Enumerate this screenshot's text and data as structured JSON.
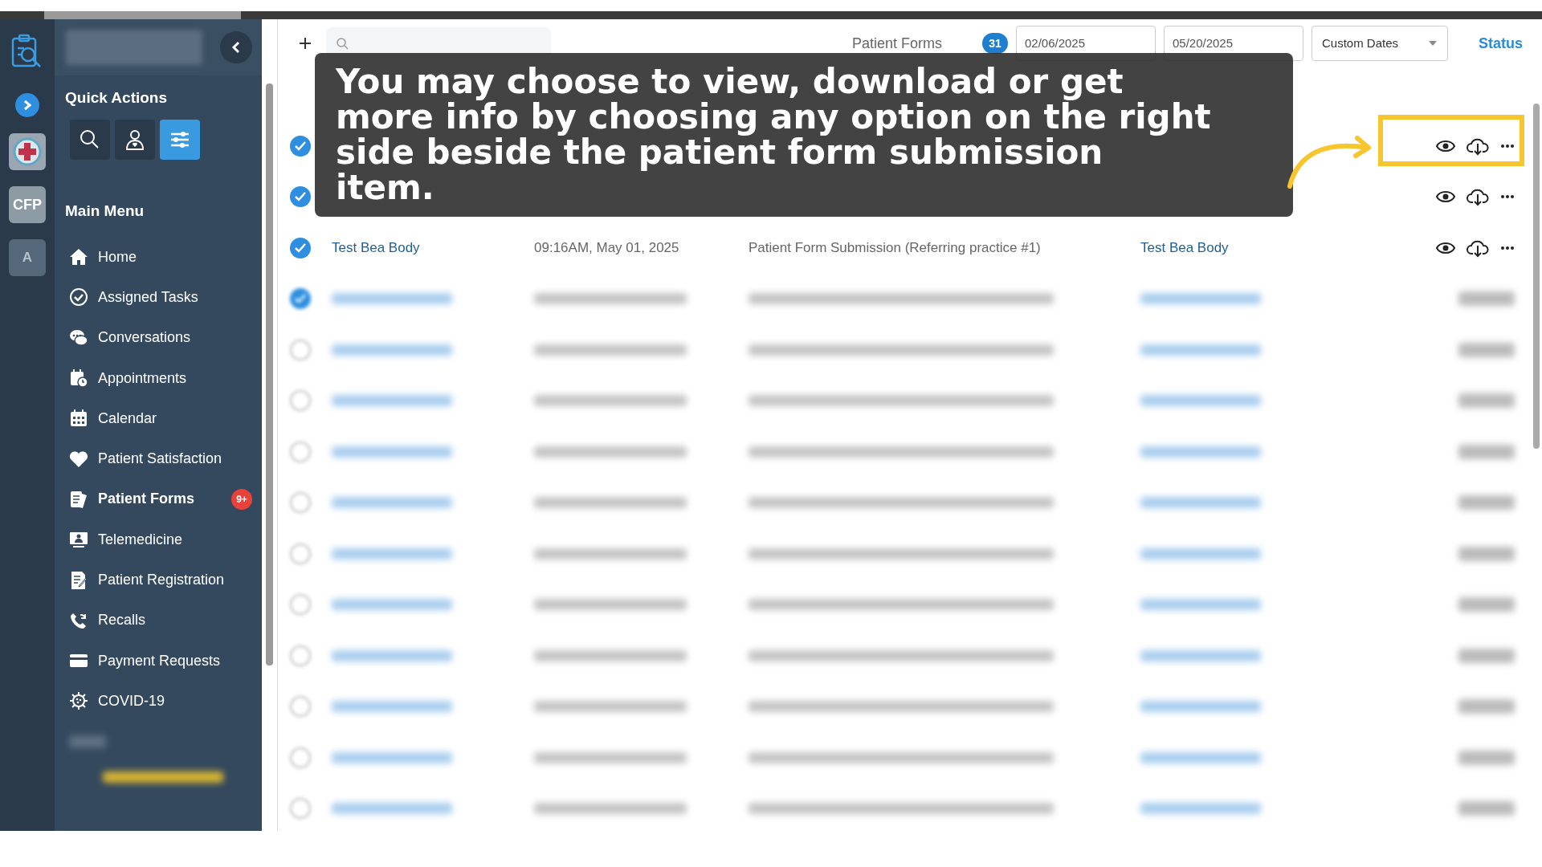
{
  "rail": {
    "accounts": [
      {
        "label": "CFP",
        "selected": true
      },
      {
        "label": "A",
        "selected": false
      }
    ]
  },
  "quick_actions": {
    "title": "Quick Actions",
    "buttons": [
      {
        "kind": "search",
        "selected": false
      },
      {
        "kind": "patient",
        "selected": false
      },
      {
        "kind": "filters",
        "selected": true
      }
    ]
  },
  "main_menu": {
    "title": "Main Menu",
    "items": [
      {
        "kind": "home",
        "label": "Home",
        "selected": false
      },
      {
        "kind": "tasks",
        "label": "Assigned Tasks",
        "selected": false
      },
      {
        "kind": "chat",
        "label": "Conversations",
        "selected": false
      },
      {
        "kind": "appointments",
        "label": "Appointments",
        "selected": false
      },
      {
        "kind": "calendar",
        "label": "Calendar",
        "selected": false
      },
      {
        "kind": "heart",
        "label": "Patient Satisfaction",
        "selected": false
      },
      {
        "kind": "forms",
        "label": "Patient Forms",
        "selected": true,
        "badge": "9+"
      },
      {
        "kind": "telemedicine",
        "label": "Telemedicine",
        "selected": false
      },
      {
        "kind": "registration",
        "label": "Patient Registration",
        "selected": false
      },
      {
        "kind": "recalls",
        "label": "Recalls",
        "selected": false
      },
      {
        "kind": "payment",
        "label": "Payment Requests",
        "selected": false
      },
      {
        "kind": "virus",
        "label": "COVID-19",
        "selected": false
      }
    ]
  },
  "header": {
    "title": "Patient Forms",
    "count": "31",
    "date_from": "02/06/2025",
    "date_to": "05/20/2025",
    "range": "Custom Dates",
    "status_link": "Status"
  },
  "table": {
    "rows": [
      {
        "kind": "visible",
        "checked": true
      },
      {
        "kind": "visible",
        "checked": true
      },
      {
        "kind": "visible",
        "checked": true,
        "name": "Test Bea Body",
        "date": "09:16AM, May 01, 2025",
        "type": "Patient Form Submission (Referring practice #1)",
        "sent_by": "Test Bea Body"
      },
      {
        "kind": "blurred",
        "checked": true
      },
      {
        "kind": "blurred",
        "checked": false
      },
      {
        "kind": "blurred",
        "checked": false
      },
      {
        "kind": "blurred",
        "checked": false
      },
      {
        "kind": "blurred",
        "checked": false
      },
      {
        "kind": "blurred",
        "checked": false
      },
      {
        "kind": "blurred",
        "checked": false
      },
      {
        "kind": "blurred",
        "checked": false
      },
      {
        "kind": "blurred",
        "checked": false
      },
      {
        "kind": "blurred",
        "checked": false
      },
      {
        "kind": "blurred",
        "checked": false
      }
    ]
  },
  "tutorial": {
    "text": "You may choose to view, download or get more info by choosing any option on the right side beside the patient form submission item."
  }
}
